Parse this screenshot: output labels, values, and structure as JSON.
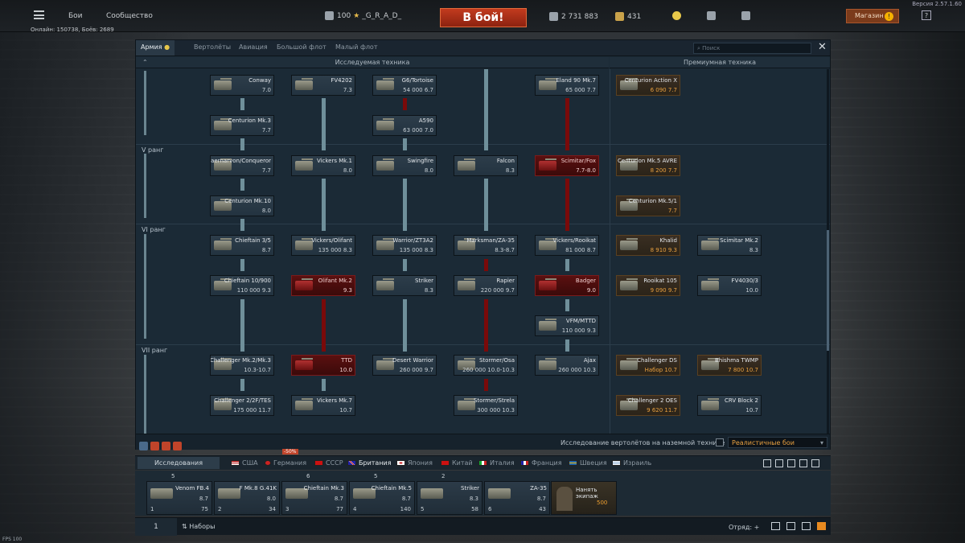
{
  "topbar": {
    "menu_items": [
      "Бои",
      "Сообщество"
    ],
    "level": "100",
    "player": "_G_R_A_D_",
    "battle_button": "В бой!",
    "silver": "2 731 883",
    "gold": "431",
    "shop_label": "Магазин",
    "shop_badge": "!",
    "version": "Версия 2.57.1.60",
    "online": "Онлайн: 150738, Боёв: 2689",
    "help": "?"
  },
  "tabs": [
    "Армия",
    "Вертолёты",
    "Авиация",
    "Большой флот",
    "Малый флот"
  ],
  "search_placeholder": "Поиск",
  "sections": {
    "research": "Исследуемая техника",
    "premium": "Премиумная техника"
  },
  "ranks": [
    "V ранг",
    "VI ранг",
    "VII ранг"
  ],
  "cards": [
    {
      "name": "Conway",
      "stats": "7.0"
    },
    {
      "name": "FV4202",
      "stats": "7.3"
    },
    {
      "name": "G6/Tortoise",
      "stats": "54 000 6.7"
    },
    {
      "name": "Eland 90 Mk.7",
      "stats": "65 000 7.7"
    },
    {
      "name": "Centurion Action X",
      "stats": "6 090 7.7"
    },
    {
      "name": "Centurion Mk.3",
      "stats": "7.7"
    },
    {
      "name": "A590",
      "stats": "63 000 7.0"
    },
    {
      "name": "Caernarvon/Conqueror",
      "stats": "7.7"
    },
    {
      "name": "Vickers Mk.1",
      "stats": "8.0"
    },
    {
      "name": "Swingfire",
      "stats": "8.0"
    },
    {
      "name": "Falcon",
      "stats": "8.3"
    },
    {
      "name": "Scimitar/Fox",
      "stats": "7.7-8.0"
    },
    {
      "name": "Centurion Mk.5 AVRE",
      "stats": "8 200 7.7"
    },
    {
      "name": "Centurion Mk.10",
      "stats": "8.0"
    },
    {
      "name": "Centurion Mk.5/1",
      "stats": "7.7"
    },
    {
      "name": "Chieftain 3/5",
      "stats": "8.7"
    },
    {
      "name": "Vickers/Olifant",
      "stats": "135 000 8.3"
    },
    {
      "name": "Warrior/ZT3A2",
      "stats": "135 000 8.3"
    },
    {
      "name": "Marksman/ZA-35",
      "stats": "8.3-8.7"
    },
    {
      "name": "Vickers/Rooikat",
      "stats": "81 000 8.7"
    },
    {
      "name": "Khalid",
      "stats": "8 910 9.3"
    },
    {
      "name": "Scimitar Mk.2",
      "stats": "8.3"
    },
    {
      "name": "Chieftain 10/900",
      "stats": "110 000 9.3"
    },
    {
      "name": "Olifant Mk.2",
      "stats": "9.3"
    },
    {
      "name": "Striker",
      "stats": "8.3"
    },
    {
      "name": "Rapier",
      "stats": "220 000 9.7"
    },
    {
      "name": "Badger",
      "stats": "9.0"
    },
    {
      "name": "Rooikat 105",
      "stats": "9 090 9.7"
    },
    {
      "name": "FV4030/3",
      "stats": "10.0"
    },
    {
      "name": "VFM/MTTD",
      "stats": "110 000 9.3"
    },
    {
      "name": "Challenger Mk.2/Mk.3",
      "stats": "10.3-10.7"
    },
    {
      "name": "TTD",
      "stats": "10.0"
    },
    {
      "name": "Desert Warrior",
      "stats": "260 000 9.7"
    },
    {
      "name": "Stormer/Osa",
      "stats": "260 000 10.0-10.3"
    },
    {
      "name": "Ajax",
      "stats": "260 000 10.3"
    },
    {
      "name": "Challenger DS",
      "stats": "Набор 10.7"
    },
    {
      "name": "Bhishma TWMP",
      "stats": "7 800 10.7"
    },
    {
      "name": "Challenger 2/2F/TES",
      "stats": "175 000 11.7"
    },
    {
      "name": "Vickers Mk.7",
      "stats": "10.7"
    },
    {
      "name": "Stormer/Strela",
      "stats": "300 000 10.3"
    },
    {
      "name": "Challenger 2 OES",
      "stats": "9 620 11.7"
    },
    {
      "name": "CRV Block 2",
      "stats": "10.7"
    }
  ],
  "bottom_bar": {
    "label": "Исследование вертолётов на наземной технике",
    "mode": "Реалистичные бои"
  },
  "nation_bar": {
    "research": "Исследования",
    "discount": "-50%",
    "nations": [
      "США",
      "Германия",
      "СССР",
      "Британия",
      "Япония",
      "Китай",
      "Италия",
      "Франция",
      "Швеция",
      "Израиль"
    ]
  },
  "crew_slots": [
    {
      "header": "5",
      "name": "Venom FB.4",
      "br": "8.7",
      "index": "1",
      "count": "75"
    },
    {
      "header": "",
      "name": "F Mk.8 G.41K",
      "br": "8.0",
      "index": "2",
      "count": "34"
    },
    {
      "header": "6",
      "name": "Chieftain Mk.3",
      "br": "8.7",
      "index": "3",
      "count": "77"
    },
    {
      "header": "5",
      "name": "Chieftain Mk.5",
      "br": "8.7",
      "index": "4",
      "count": "140"
    },
    {
      "header": "2",
      "name": "Striker",
      "br": "8.3",
      "index": "5",
      "count": "58"
    },
    {
      "header": "",
      "name": "ZA-35",
      "br": "8.7",
      "index": "6",
      "count": "43"
    }
  ],
  "crew_buy": {
    "label": "Нанять экипаж",
    "price": "500"
  },
  "footer": {
    "page": "1",
    "presets": "Наборы",
    "squad": "Отряд:"
  },
  "fps": "FPS 100"
}
